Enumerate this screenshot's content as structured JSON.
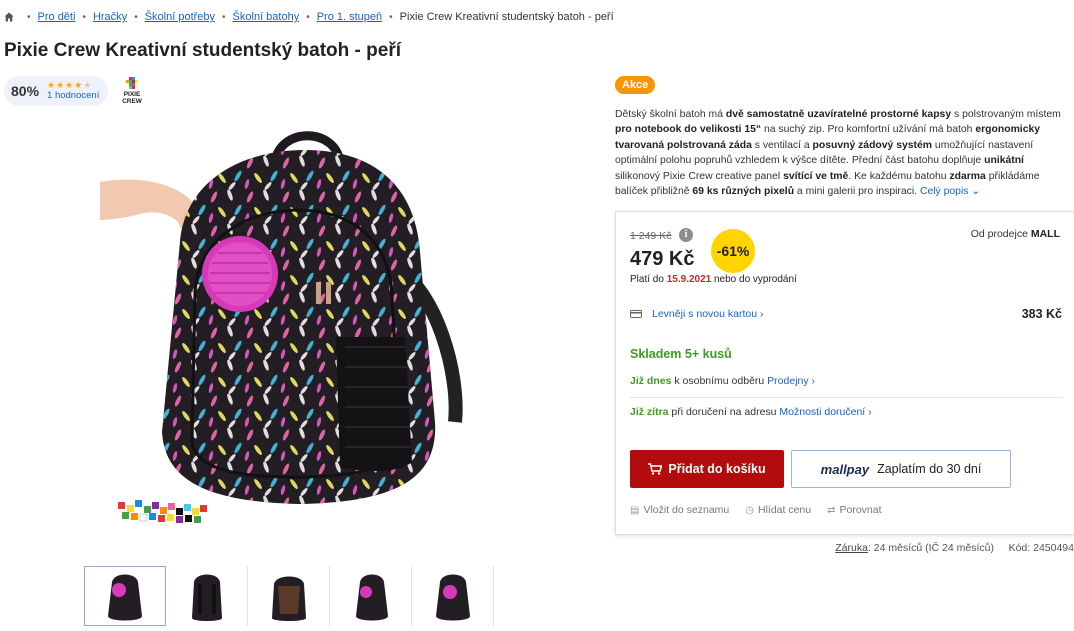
{
  "breadcrumb": {
    "items": [
      "Pro děti",
      "Hračky",
      "Školní potřeby",
      "Školní batohy",
      "Pro 1. stupeň"
    ],
    "current": "Pixie Crew Kreativní studentský batoh - peří"
  },
  "product": {
    "title": "Pixie Crew Kreativní studentský batoh - peří",
    "rating_percent": "80%",
    "rating_stars": 4,
    "reviews_text": "1 hodnocení",
    "brand_logo_text": "PIXIE CREW"
  },
  "badge": {
    "label": "Akce",
    "color": "#f89406"
  },
  "description": {
    "parts": [
      {
        "t": "Dětský školní batoh má ",
        "b": false
      },
      {
        "t": "dvě samostatně uzavíratelné prostorné kapsy",
        "b": true
      },
      {
        "t": " s polstrovaným místem ",
        "b": false
      },
      {
        "t": "pro notebook do velikosti 15“",
        "b": true
      },
      {
        "t": " na suchý zip. Pro komfortní užívání má batoh ",
        "b": false
      },
      {
        "t": "ergonomicky tvarovaná polstrovaná záda",
        "b": true
      },
      {
        "t": " s ventilací a ",
        "b": false
      },
      {
        "t": "posuvný zádový systém",
        "b": true
      },
      {
        "t": " umožňující nastavení optimální polohu popruhů vzhledem k výšce dítěte. Přední část batohu doplňuje ",
        "b": false
      },
      {
        "t": "unikátní",
        "b": true
      },
      {
        "t": " silikonový Pixie Crew creative panel ",
        "b": false
      },
      {
        "t": "svítící ve tmě",
        "b": true
      },
      {
        "t": ". Ke každému batohu ",
        "b": false
      },
      {
        "t": "zdarma",
        "b": true
      },
      {
        "t": " přikládáme balíček přibližně ",
        "b": false
      },
      {
        "t": "69 ks různých pixelů",
        "b": true
      },
      {
        "t": " a mini galerii pro inspiraci. ",
        "b": false
      }
    ],
    "more_label": "Celý popis"
  },
  "pricing": {
    "old_price": "1 249 Kč",
    "info_icon": "i",
    "discount": "-61%",
    "price": "479 Kč",
    "valid_prefix": "Platí do ",
    "valid_date": "15.9.2021",
    "valid_suffix": " nebo do vyprodání",
    "seller_prefix": "Od prodejce ",
    "seller_name": "MALL",
    "card_label": "Levněji s novou kartou",
    "card_price": "383 Kč"
  },
  "availability": {
    "stock": "Skladem 5+ kusů",
    "pickup_when": "Již dnes",
    "pickup_text": " k osobnímu odběru ",
    "pickup_link": "Prodejny",
    "delivery_when": "Již zítra",
    "delivery_text": " při doručení na adresu ",
    "delivery_link": "Možnosti doručení"
  },
  "buttons": {
    "add_to_cart": "Přidat do košíku",
    "mallpay_logo": "mallpay",
    "mallpay_text": "Zaplatím do 30 dní"
  },
  "actions": [
    "Vložit do seznamu",
    "Hlídat cenu",
    "Porovnat"
  ],
  "footer": {
    "warranty_label": "Záruka",
    "warranty_value": ": 24 měsíců (IČ 24 měsíců)",
    "code_label": "Kód:",
    "code_value": "2450494"
  },
  "colors": {
    "accent_red": "#b20c0c",
    "link_blue": "#1565c0",
    "stock_green": "#3c9c25",
    "discount_yellow": "#ffd400"
  }
}
